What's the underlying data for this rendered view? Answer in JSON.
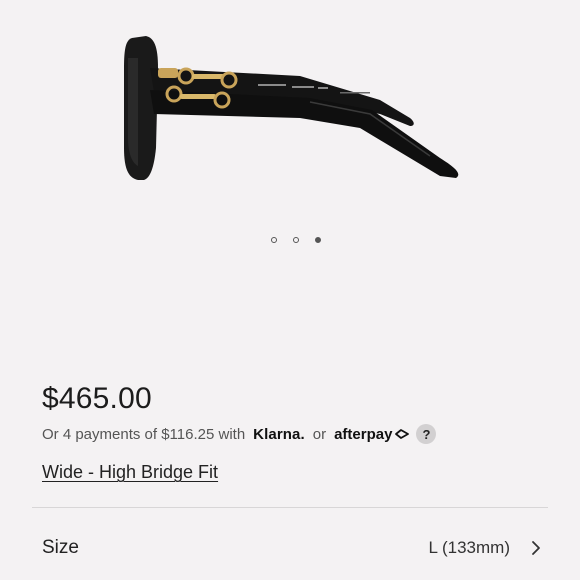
{
  "product": {
    "image_icon": "sunglasses-side-view",
    "carousel": {
      "dot_count": 3,
      "active_index": 2
    },
    "price": "$465.00",
    "installments": {
      "text": "Or 4 payments of $116.25 with",
      "klarna": "Klarna.",
      "or": "or",
      "afterpay": "afterpay",
      "help": "?"
    },
    "fit_link": "Wide - High Bridge Fit",
    "size": {
      "label": "Size",
      "value": "L (133mm)"
    }
  },
  "colors": {
    "background": "#f4f2f3",
    "text": "#222222",
    "muted": "#555555"
  }
}
